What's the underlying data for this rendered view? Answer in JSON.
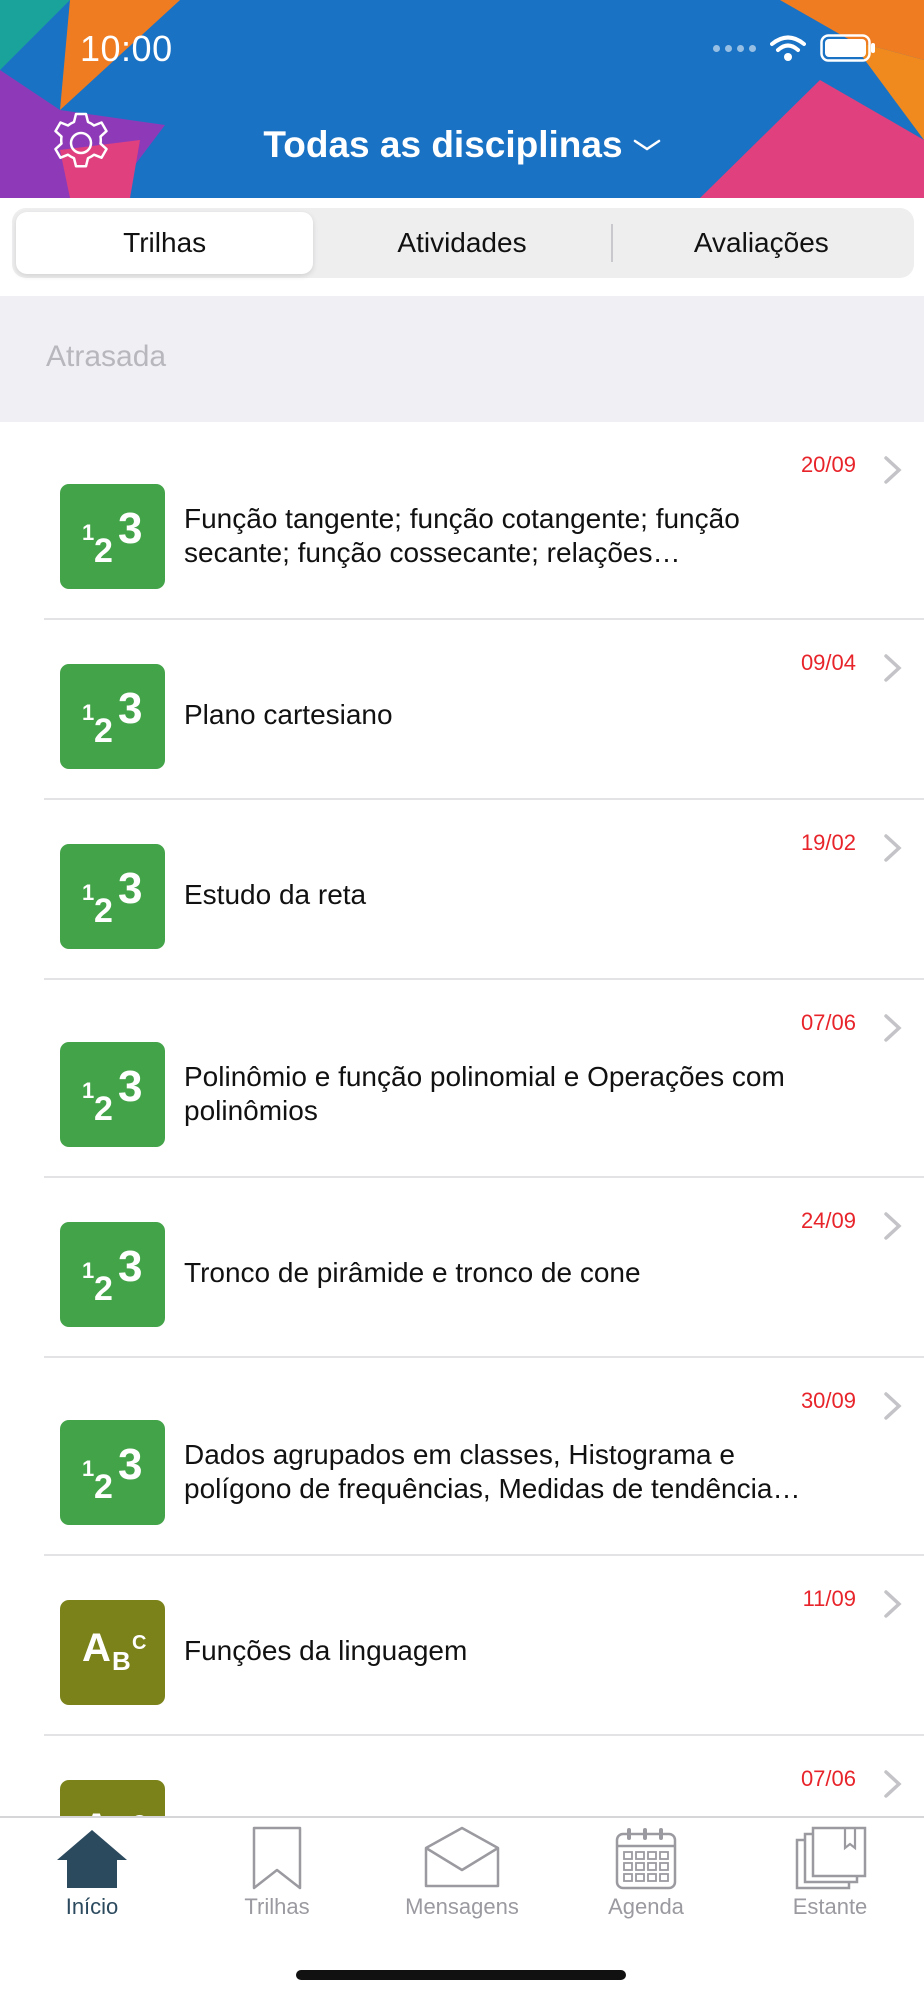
{
  "status_bar": {
    "time": "10:00"
  },
  "header": {
    "title": "Todas as disciplinas"
  },
  "segments": [
    {
      "label": "Trilhas",
      "active": true
    },
    {
      "label": "Atividades",
      "active": false
    },
    {
      "label": "Avaliações",
      "active": false
    }
  ],
  "section": {
    "title": "Atrasada"
  },
  "items": [
    {
      "date": "20/09",
      "title": "Função tangente; função cotangente; função secante; função cossecante; relações trigonométricas",
      "icon": "numbers-icon"
    },
    {
      "date": "09/04",
      "title": "Plano cartesiano",
      "icon": "numbers-icon"
    },
    {
      "date": "19/02",
      "title": "Estudo da reta",
      "icon": "numbers-icon"
    },
    {
      "date": "07/06",
      "title": "Polinômio e função polinomial e Operações com polinômios",
      "icon": "numbers-icon"
    },
    {
      "date": "24/09",
      "title": "Tronco de pirâmide e tronco de cone",
      "icon": "numbers-icon"
    },
    {
      "date": "30/09",
      "title": "Dados agrupados em classes, Histograma e polígono de frequências,  Medidas de tendência central",
      "icon": "numbers-icon"
    },
    {
      "date": "11/09",
      "title": "Funções da linguagem",
      "icon": "letters-icon"
    },
    {
      "date": "07/06",
      "title": "",
      "icon": "letters-icon"
    }
  ],
  "tabbar": [
    {
      "label": "Início",
      "icon": "home-icon",
      "active": true
    },
    {
      "label": "Trilhas",
      "icon": "bookmark-icon",
      "active": false
    },
    {
      "label": "Mensagens",
      "icon": "envelope-icon",
      "active": false
    },
    {
      "label": "Agenda",
      "icon": "calendar-icon",
      "active": false
    },
    {
      "label": "Estante",
      "icon": "bookshelf-icon",
      "active": false
    }
  ],
  "colors": {
    "header_blue": "#1a72c4",
    "math_green": "#43a348",
    "language_olive": "#7b8219",
    "overdue_red": "#e8242b",
    "active_tab": "#2c4a5e"
  }
}
